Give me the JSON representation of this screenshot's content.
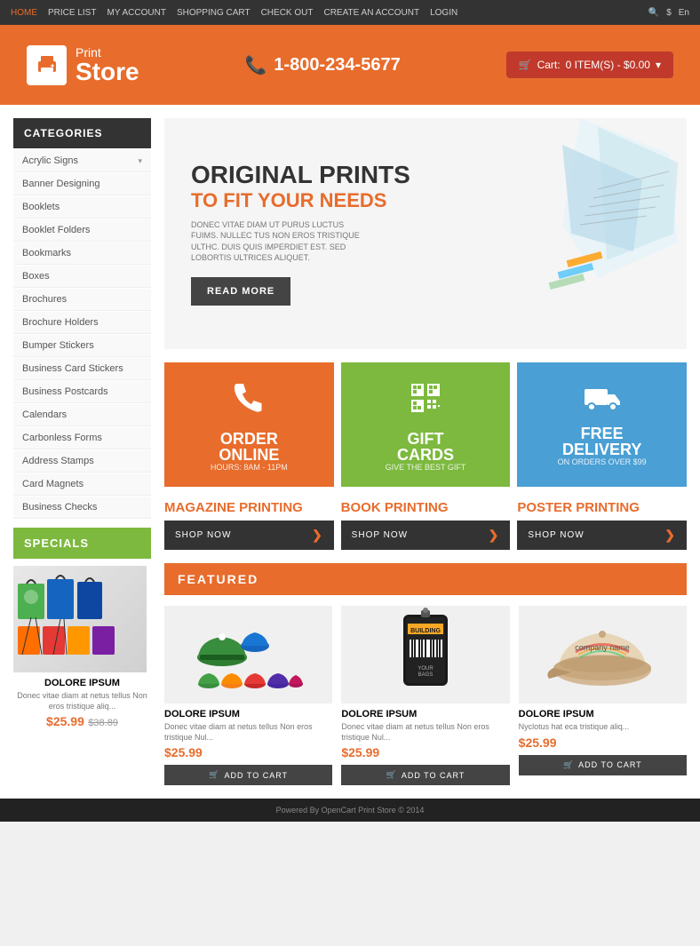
{
  "topbar": {
    "nav": [
      "HOME",
      "PRICE LIST",
      "MY ACCOUNT",
      "SHOPPING CART",
      "CHECK OUT",
      "CREATE AN ACCOUNT",
      "LOGIN"
    ],
    "active": "HOME",
    "right_icon": "search",
    "lang": "En"
  },
  "header": {
    "logo_print": "Print",
    "logo_store": "Store",
    "phone": "1-800-234-5677",
    "cart_label": "Cart:",
    "cart_items": "0 ITEM(S) - $0.00"
  },
  "sidebar": {
    "categories_label": "CATEGORIES",
    "items": [
      {
        "label": "Acrylic Signs",
        "has_children": true
      },
      {
        "label": "Banner Designing",
        "has_children": false
      },
      {
        "label": "Booklets",
        "has_children": false
      },
      {
        "label": "Booklet Folders",
        "has_children": false
      },
      {
        "label": "Bookmarks",
        "has_children": false
      },
      {
        "label": "Boxes",
        "has_children": false
      },
      {
        "label": "Brochures",
        "has_children": false
      },
      {
        "label": "Brochure Holders",
        "has_children": false
      },
      {
        "label": "Bumper Stickers",
        "has_children": false
      },
      {
        "label": "Business Card Stickers",
        "has_children": false
      },
      {
        "label": "Business Postcards",
        "has_children": false
      },
      {
        "label": "Calendars",
        "has_children": false
      },
      {
        "label": "Carbonless Forms",
        "has_children": false
      },
      {
        "label": "Address Stamps",
        "has_children": false
      },
      {
        "label": "Card Magnets",
        "has_children": false
      },
      {
        "label": "Business Checks",
        "has_children": false
      }
    ],
    "specials_label": "SPECIALS",
    "specials_product": {
      "title": "DOLORE IPSUM",
      "desc": "Donec vitae diam at netus tellus Non eros tristique aliq...",
      "price": "$25.99",
      "old_price": "$38.89"
    }
  },
  "hero": {
    "title": "ORIGINAL PRINTS",
    "subtitle": "TO FIT YOUR NEEDS",
    "desc": "DONEC VITAE DIAM UT PURUS LUCTUS FUIMS. NULLEC TUS NON EROS TRISTIQUE ULTHC. DUIS QUIS IMPERDIET EST. SED LOBORTIS ULTRICES ALIQUET.",
    "cta": "READ MORE"
  },
  "features": [
    {
      "title": "ORDER\nONLINE",
      "sub": "",
      "note": "HOURS: 8AM - 11PM",
      "color": "orange",
      "icon": "phone"
    },
    {
      "title": "GIFT\nCARDS",
      "sub": "",
      "note": "GIVE THE BEST GIFT",
      "color": "green",
      "icon": "qr"
    },
    {
      "title": "FREE\nDELIVERY",
      "sub": "",
      "note": "ON ORDERS OVER $99",
      "color": "blue",
      "icon": "truck"
    }
  ],
  "printing": [
    {
      "category": "MAGAZINE",
      "type": "PRINTING",
      "btn": "SHOP NOW"
    },
    {
      "category": "BOOK",
      "type": "PRINTING",
      "btn": "SHOP NOW"
    },
    {
      "category": "POSTER",
      "type": "PRINTING",
      "btn": "SHOP NOW"
    }
  ],
  "featured": {
    "label": "FEATURED",
    "products": [
      {
        "title": "DOLORE IPSUM",
        "desc": "Donec vitae diam at netus tellus Non eros tristique Nul...",
        "price": "$25.99",
        "btn": "ADD TO CART",
        "type": "hats_colorful"
      },
      {
        "title": "DOLORE IPSUM",
        "desc": "Donec vitae diam at netus tellus Non eros tristique Nul...",
        "price": "$25.99",
        "btn": "ADD TO CART",
        "type": "tag"
      },
      {
        "title": "DOLORE IPSUM",
        "desc": "Nyclotus hat eca tristique aliq...",
        "price": "$25.99",
        "btn": "ADD TO CART",
        "type": "hat_beige"
      }
    ]
  },
  "footer": {
    "text": "Powered By OpenCart Print Store © 2014"
  }
}
